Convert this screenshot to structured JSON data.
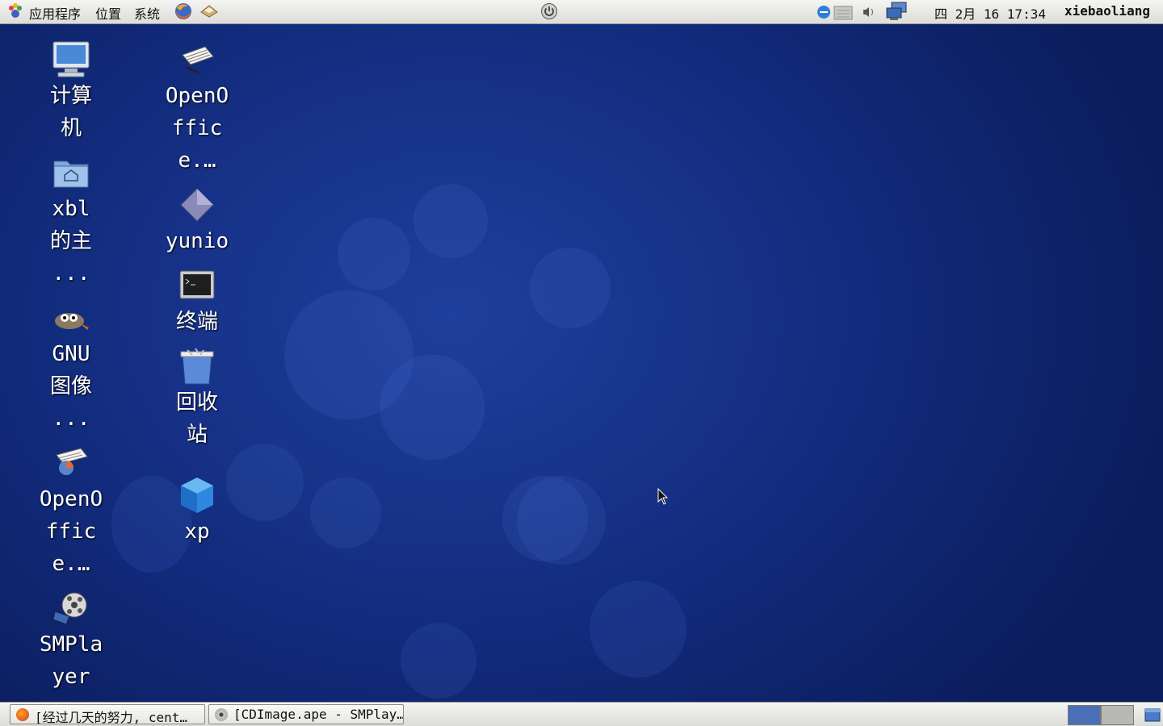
{
  "top_panel": {
    "menus": [
      "应用程序",
      "位置",
      "系统"
    ],
    "clock": "四 2月 16 17:34",
    "user": "xiebaoliang"
  },
  "desktop": {
    "icons_col1": [
      {
        "label_lines": [
          "计算",
          "机"
        ],
        "icon": "computer-icon"
      },
      {
        "label_lines": [
          "xbl",
          "的主",
          "..."
        ],
        "icon": "home-folder-icon"
      },
      {
        "label_lines": [
          "GNU",
          "图像",
          "..."
        ],
        "icon": "gimp-icon"
      },
      {
        "label_lines": [
          "OpenO",
          "ffic",
          "e.…"
        ],
        "icon": "openoffice-impress-icon"
      },
      {
        "label_lines": [
          "SMPla",
          "yer"
        ],
        "icon": "smplayer-icon"
      }
    ],
    "icons_col2": [
      {
        "label_lines": [
          "OpenO",
          "ffic",
          "e.…"
        ],
        "icon": "openoffice-writer-icon"
      },
      {
        "label_lines": [
          "yunio"
        ],
        "icon": "yunio-icon"
      },
      {
        "label_lines": [
          "终端"
        ],
        "icon": "terminal-icon"
      },
      {
        "label_lines": [
          "回收",
          "站"
        ],
        "icon": "trash-icon"
      },
      {
        "label_lines": [
          "xp"
        ],
        "icon": "virtualbox-icon"
      }
    ]
  },
  "taskbar": {
    "tasks": [
      "[经过几天的努力, cent…",
      "[CDImage.ape - SMPlay…"
    ]
  },
  "colors": {
    "panel_bg": "#e8e8e6",
    "desktop_blue": "#17338a",
    "workspace_active": "#4a6fb5",
    "workspace_inactive": "#b8b8b4"
  }
}
